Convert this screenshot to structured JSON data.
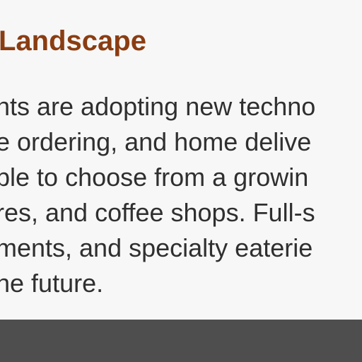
{
  "article": {
    "heading": "Landscape",
    "lines": [
      "nts are adopting new techno",
      "e ordering, and home delive",
      "ble to choose from a growin",
      "res, and coffee shops. Full-s",
      "ments, and specialty eaterie",
      "he future."
    ]
  },
  "colors": {
    "heading": "#8a3d12",
    "body_text": "#2f2f2f",
    "background": "#f7f7f7",
    "footer": "#4e4e4e"
  }
}
